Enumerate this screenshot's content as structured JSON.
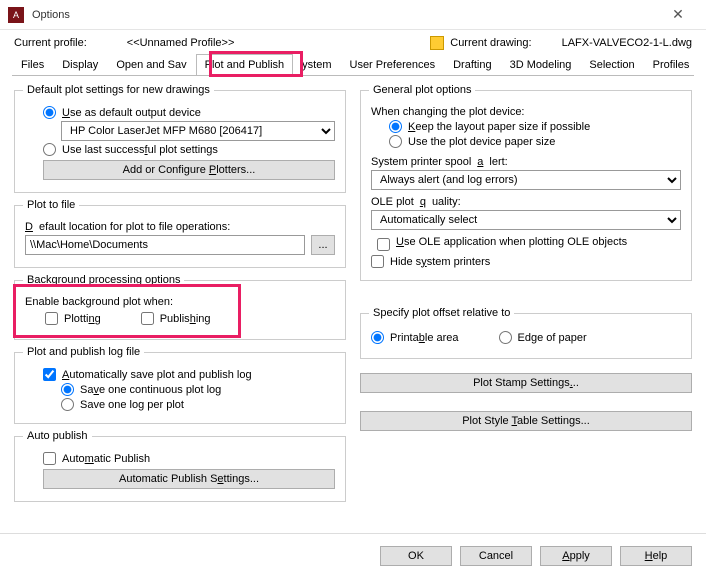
{
  "window": {
    "title": "Options"
  },
  "profile": {
    "label": "Current profile:",
    "value": "<<Unnamed Profile>>",
    "drawing_label": "Current drawing:",
    "drawing_value": "LAFX-VALVECO2-1-L.dwg"
  },
  "tabs": {
    "files": "Files",
    "display": "Display",
    "open_save": "Open and Sav",
    "plot_publish": "Plot and Publish",
    "system": "ystem",
    "user_prefs": "User Preferences",
    "drafting": "Drafting",
    "modeling": "3D Modeling",
    "selection": "Selection",
    "profiles": "Profiles"
  },
  "left": {
    "defPlot": {
      "legend": "Default plot settings for new drawings",
      "useDefault": "Use as default output device",
      "printer": "HP Color LaserJet MFP M680 [206417]",
      "useLast": "Use last successful plot settings",
      "configBtn": "Add or Configure Plotters..."
    },
    "plotToFile": {
      "legend": "Plot to file",
      "label": "Default location for plot to file operations:",
      "path": "\\\\Mac\\Home\\Documents"
    },
    "bg": {
      "legend": "Background processing options",
      "label": "Enable background plot when:",
      "plotting": "Plotting",
      "publishing": "Publishing"
    },
    "log": {
      "legend": "Plot and publish log file",
      "autoSave": "Automatically save plot and publish log",
      "oneCont": "Save one continuous plot log",
      "onePer": "Save one log per plot"
    },
    "autoPub": {
      "legend": "Auto publish",
      "chk": "Automatic Publish",
      "btn": "Automatic Publish Settings..."
    }
  },
  "right": {
    "general": {
      "legend": "General plot options",
      "whenChanging": "When changing the plot device:",
      "keepLayout": "Keep the layout paper size if possible",
      "usePlotDevice": "Use the plot device paper size",
      "spoolLabel": "System printer spool alert:",
      "spoolValue": "Always alert (and log errors)",
      "oleLabel": "OLE plot quality:",
      "oleValue": "Automatically select",
      "useOle": "Use OLE application when plotting OLE objects",
      "hidePrinters": "Hide system printers"
    },
    "offset": {
      "legend": "Specify plot offset relative to",
      "printable": "Printable area",
      "edge": "Edge of paper"
    },
    "plotStamp": "Plot Stamp Settings...",
    "plotStyle": "Plot Style Table Settings..."
  },
  "footer": {
    "ok": "OK",
    "cancel": "Cancel",
    "apply": "Apply",
    "help": "Help"
  }
}
